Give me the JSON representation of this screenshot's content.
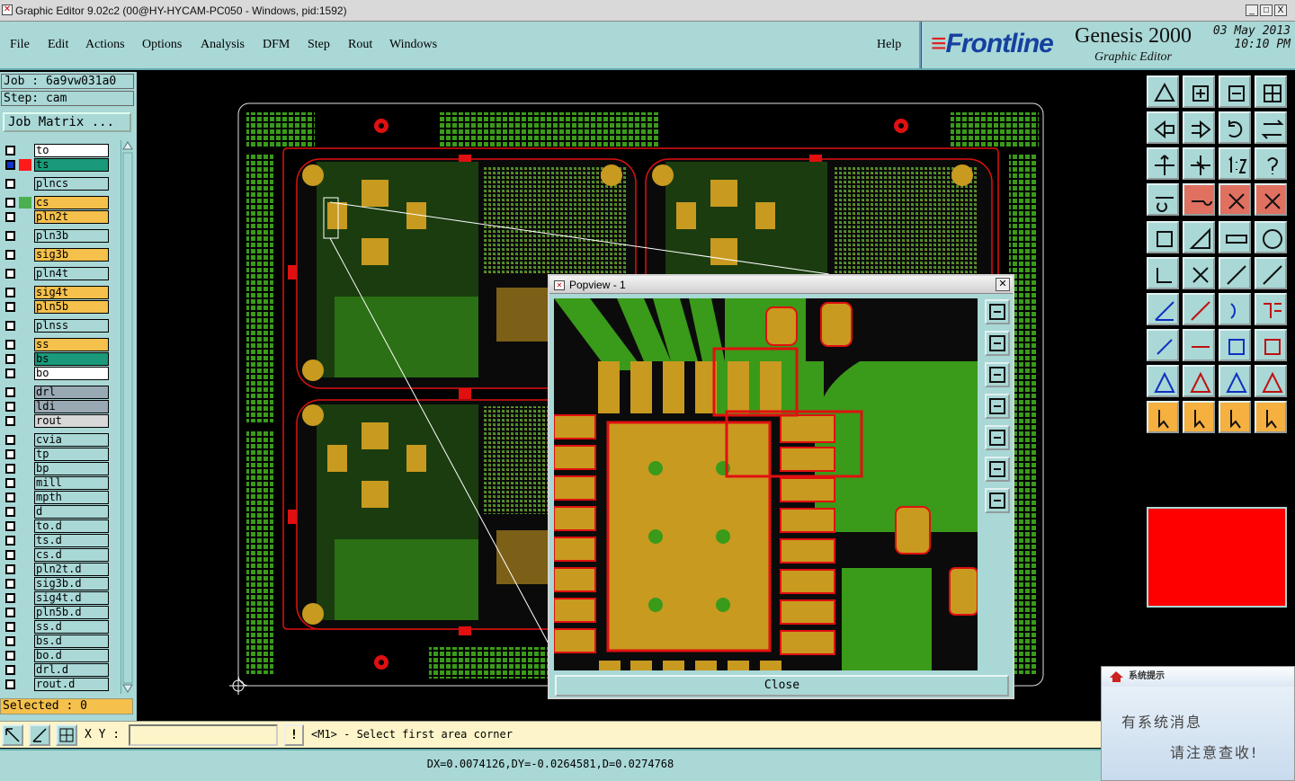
{
  "window": {
    "title": "Graphic Editor 9.02c2 (00@HY-HYCAM-PC050 - Windows, pid:1592)",
    "minimize": "_",
    "maximize": "□",
    "close": "X"
  },
  "menu": {
    "file": "File",
    "edit": "Edit",
    "actions": "Actions",
    "options": "Options",
    "analysis": "Analysis",
    "dfm": "DFM",
    "step": "Step",
    "rout": "Rout",
    "windows": "Windows",
    "help": "Help"
  },
  "brand": {
    "logo": "Frontline",
    "product": "Genesis 2000",
    "subtitle": "Graphic Editor",
    "date": "03 May 2013",
    "time": "10:10 PM"
  },
  "left": {
    "job": "Job : 6a9vw031a0",
    "step": "Step: cam",
    "job_matrix": "Job Matrix ...",
    "selected": "Selected : 0"
  },
  "layers": [
    {
      "name": "to",
      "color": "#ffffff"
    },
    {
      "name": "ts",
      "color": "#1a9a7a"
    },
    {
      "name": "plncs",
      "color": "#a9d8d6"
    },
    {
      "name": "cs",
      "color": "#f5c04b"
    },
    {
      "name": "pln2t",
      "color": "#f5c04b"
    },
    {
      "name": "pln3b",
      "color": "#a9d8d6"
    },
    {
      "name": "sig3b",
      "color": "#f5c04b"
    },
    {
      "name": "pln4t",
      "color": "#a9d8d6"
    },
    {
      "name": "sig4t",
      "color": "#f5c04b"
    },
    {
      "name": "pln5b",
      "color": "#f5c04b"
    },
    {
      "name": "plnss",
      "color": "#a9d8d6"
    },
    {
      "name": "ss",
      "color": "#f5c04b"
    },
    {
      "name": "bs",
      "color": "#1a9a7a"
    },
    {
      "name": "bo",
      "color": "#ffffff"
    },
    {
      "name": "drl",
      "color": "#99a9b4"
    },
    {
      "name": "ldi",
      "color": "#99a9b4"
    },
    {
      "name": "rout",
      "color": "#d8d8d8"
    },
    {
      "name": "cvia",
      "color": "#a9d8d6"
    },
    {
      "name": "tp",
      "color": "#a9d8d6"
    },
    {
      "name": "bp",
      "color": "#a9d8d6"
    },
    {
      "name": "mill",
      "color": "#a9d8d6"
    },
    {
      "name": "mpth",
      "color": "#a9d8d6"
    },
    {
      "name": "d",
      "color": "#a9d8d6"
    },
    {
      "name": "to.d",
      "color": "#a9d8d6"
    },
    {
      "name": "ts.d",
      "color": "#a9d8d6"
    },
    {
      "name": "cs.d",
      "color": "#a9d8d6"
    },
    {
      "name": "pln2t.d",
      "color": "#a9d8d6"
    },
    {
      "name": "sig3b.d",
      "color": "#a9d8d6"
    },
    {
      "name": "sig4t.d",
      "color": "#a9d8d6"
    },
    {
      "name": "pln5b.d",
      "color": "#a9d8d6"
    },
    {
      "name": "ss.d",
      "color": "#a9d8d6"
    },
    {
      "name": "bs.d",
      "color": "#a9d8d6"
    },
    {
      "name": "bo.d",
      "color": "#a9d8d6"
    },
    {
      "name": "drl.d",
      "color": "#a9d8d6"
    },
    {
      "name": "rout.d",
      "color": "#a9d8d6"
    }
  ],
  "popview": {
    "title": "Popview - 1",
    "close": "Close"
  },
  "status": {
    "xy_label": "X Y :",
    "alert": "!",
    "prompt": "<M1> - Select first area corner",
    "coords": "DX=0.0074126,DY=-0.0264581,D=0.0274768"
  },
  "message_popup": {
    "title": "系统提示",
    "line1": "有系统消息",
    "line2": "请注意查收!"
  },
  "colors": {
    "panel": "#a9d8d6",
    "copper_gold": "#c8a000",
    "copper_green": "#3a9a1a",
    "outline_red": "#e01010",
    "active_color": "#ff0000"
  }
}
